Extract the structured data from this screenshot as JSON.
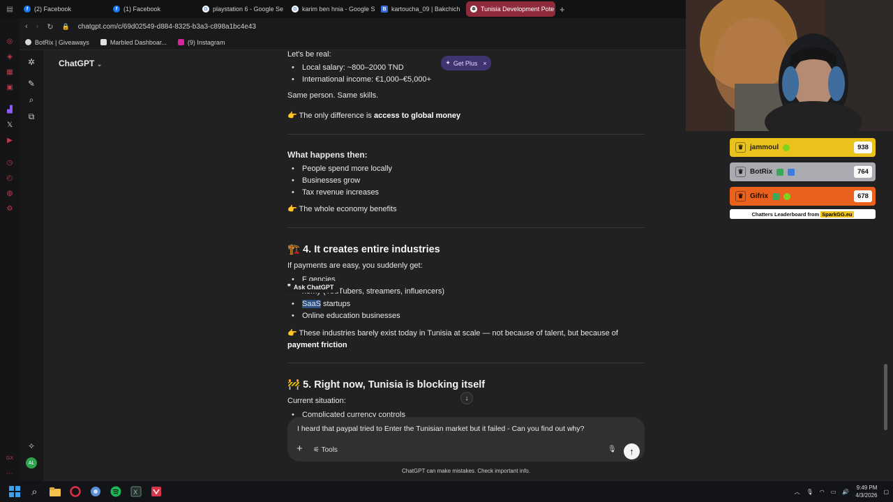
{
  "browser": {
    "tabs": [
      {
        "label": "(2) Facebook",
        "icon": "facebook-icon",
        "active": false
      },
      {
        "label": "(1) Facebook",
        "icon": "facebook-icon",
        "active": false
      },
      {
        "label": "playstation 6 - Google Se",
        "icon": "google-icon",
        "active": false
      },
      {
        "label": "karim ben hnia - Google S",
        "icon": "google-icon",
        "active": false
      },
      {
        "label": "kartoucha_09 | Bakchich",
        "icon": "bakchich-icon",
        "active": false
      },
      {
        "label": "Tunisia Development Pote",
        "icon": "chatgpt-icon",
        "active": true
      }
    ],
    "new_tab_glyph": "+",
    "url": "chatgpt.com/c/69d02549-d884-8325-b3a3-c898a1bc4e43",
    "bookmarks": [
      {
        "label": "BotRix | Giveaways",
        "icon": "botrix-icon"
      },
      {
        "label": "Marbled Dashboar...",
        "icon": "grid-icon"
      },
      {
        "label": "(9) Instagram",
        "icon": "instagram-icon"
      }
    ]
  },
  "chatgpt": {
    "title": "ChatGPT",
    "title_caret": "⌄",
    "get_plus": {
      "label": "Get Plus",
      "close": "×"
    },
    "ask_chatgpt": "Ask ChatGPT",
    "content": {
      "intro": "Let's be real:",
      "salary_items": [
        "Local salary: ~800–2000 TND",
        "International income: €1,000–€5,000+"
      ],
      "same_person": "Same person. Same skills.",
      "diff_prefix": "👉 The only difference is ",
      "diff_bold": "access to global money",
      "what_happens": "What happens then:",
      "happens_items": [
        "People spend more locally",
        "Businesses grow",
        "Tax revenue increases"
      ],
      "economy": "👉 The whole economy benefits",
      "h4_emoji": "🏗️",
      "h4": "4. It creates entire industries",
      "payments_easy": "If payments are easy, you suddenly get:",
      "industry_items": [
        {
          "before": "",
          "sel": "",
          "after": "F      gencies"
        },
        {
          "before": "",
          "sel": "",
          "after": "         nomy (YouTubers, streamers, influencers)"
        },
        {
          "before": "",
          "sel": "SaaS",
          "after": " startups"
        },
        {
          "before": "",
          "sel": "",
          "after": "Online education businesses"
        }
      ],
      "industries_line_prefix": "👉 These industries barely exist today in Tunisia at scale — not because of talent, but because of ",
      "industries_line_bold": "payment friction",
      "h5_emoji": "🚧",
      "h5": "5. Right now, Tunisia is blocking itself",
      "current": "Current situation:",
      "current_items": [
        "Complicated currency controls"
      ]
    },
    "composer": {
      "text": "I heard that paypal tried to Enter the Tunisian market but it failed - Can you find out why?",
      "plus": "+",
      "tools": "Tools",
      "mic": "🎙",
      "send": "↑"
    },
    "disclaimer": "ChatGPT can make mistakes. Check important info.",
    "scroll_down": "↓"
  },
  "leaderboard": {
    "entries": [
      {
        "name": "jammoul",
        "score": "938",
        "color": "#e9c21b",
        "text": "#2b2100"
      },
      {
        "name": "BotRix",
        "score": "764",
        "color": "#a9abb0",
        "text": "#16171a"
      },
      {
        "name": "Gifrix",
        "score": "678",
        "color": "#e9611d",
        "text": "#2a0d00"
      }
    ],
    "footer": "Chatters Leaderboard from",
    "footer_brand": "SparkGG.eu",
    "crown": "♛"
  },
  "taskbar": {
    "time": "9:49 PM",
    "date": "4/3/2026",
    "apps": [
      "windows-start-icon",
      "search-icon",
      "file-explorer-icon",
      "opera-gx-icon",
      "browser-icon",
      "spotify-icon",
      "excel-icon",
      "app-icon"
    ]
  }
}
